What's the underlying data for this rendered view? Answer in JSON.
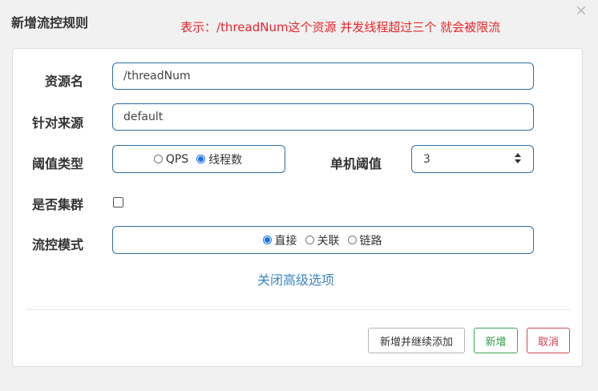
{
  "dialog": {
    "title": "新增流控规则",
    "annotation": "表示：/threadNum这个资源 并发线程超过三个 就会被限流",
    "close_icon": "×"
  },
  "form": {
    "resource_label": "资源名",
    "resource_value": "/threadNum",
    "origin_label": "针对来源",
    "origin_value": "default",
    "threshold_type_label": "阈值类型",
    "threshold_type_options": [
      {
        "label": "QPS",
        "checked": false
      },
      {
        "label": "线程数",
        "checked": true
      }
    ],
    "single_threshold_label": "单机阈值",
    "single_threshold_value": "3",
    "cluster_label": "是否集群",
    "cluster_checked": false,
    "flow_mode_label": "流控模式",
    "flow_mode_options": [
      {
        "label": "直接",
        "checked": true
      },
      {
        "label": "关联",
        "checked": false
      },
      {
        "label": "链路",
        "checked": false
      }
    ],
    "advanced_toggle": "关闭高级选项"
  },
  "buttons": {
    "add_continue": "新增并继续添加",
    "add": "新增",
    "cancel": "取消"
  },
  "colors": {
    "annotation": "#e8262c",
    "field_border": "#2d6fa3",
    "link": "#3a86c4",
    "add_button": "#3aa655",
    "cancel_button": "#cf4b55",
    "radio_checked": "#1a73e8"
  }
}
